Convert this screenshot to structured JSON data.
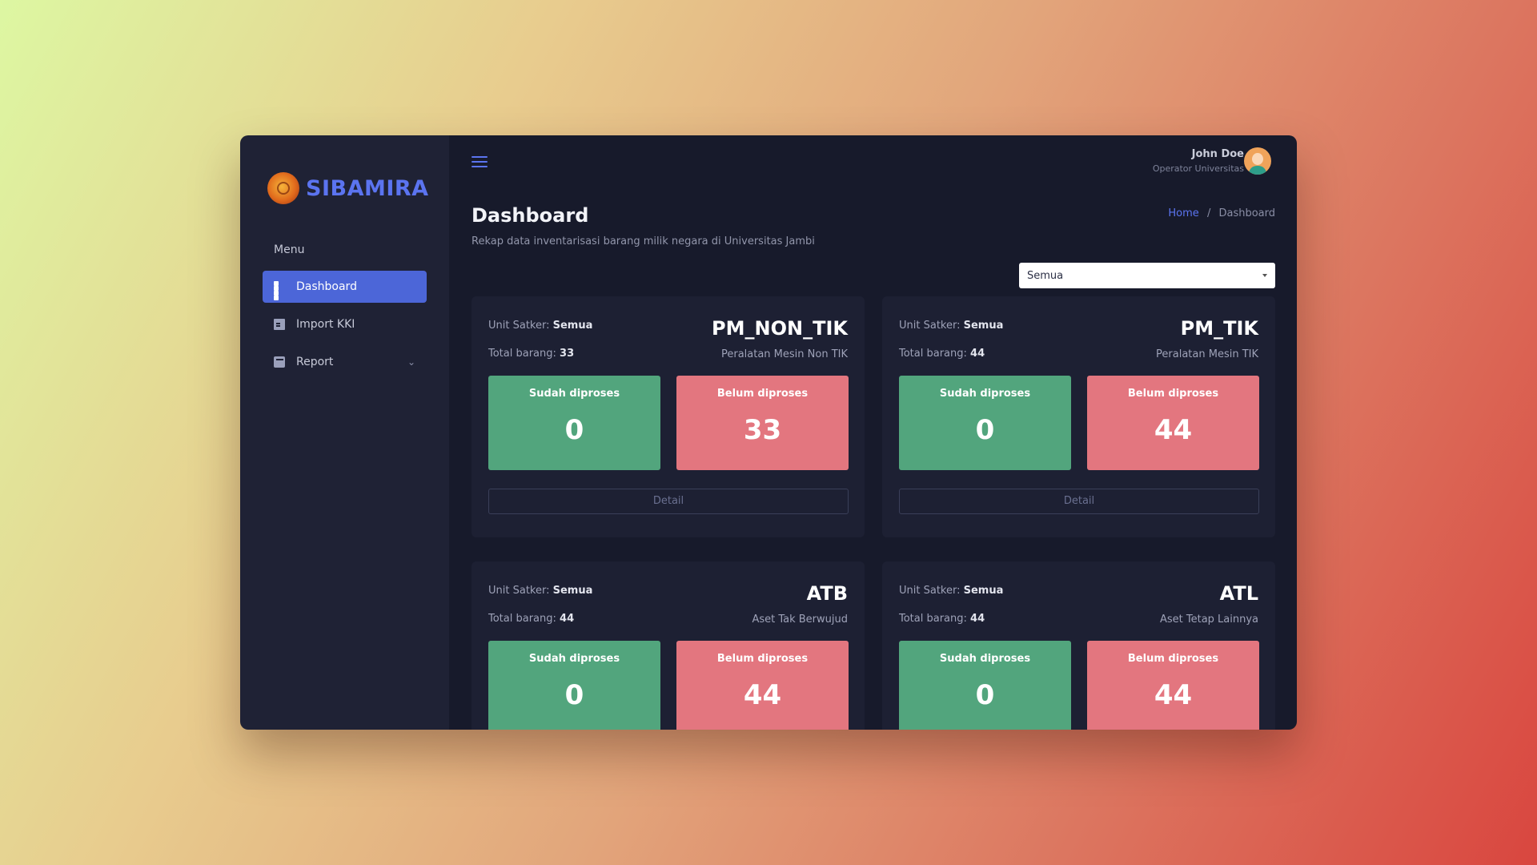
{
  "brand": {
    "name": "SIBAMIRA"
  },
  "sidebar": {
    "menu_label": "Menu",
    "items": [
      {
        "label": "Dashboard",
        "icon": "grid-icon",
        "active": true
      },
      {
        "label": "Import KKI",
        "icon": "file-icon"
      },
      {
        "label": "Report",
        "icon": "report-icon"
      }
    ]
  },
  "header": {
    "user_name": "John Doe",
    "user_role": "Operator Universitas"
  },
  "page": {
    "title": "Dashboard",
    "subtitle": "Rekap data inventarisasi barang milik negara di Universitas Jambi",
    "breadcrumb": {
      "home": "Home",
      "separator": "/",
      "current": "Dashboard"
    },
    "filter_value": "Semua"
  },
  "labels": {
    "unit_satker": "Unit Satker:",
    "total_barang": "Total barang:",
    "sudah": "Sudah diproses",
    "belum": "Belum diproses",
    "detail": "Detail"
  },
  "colors": {
    "accent": "#4c66d8",
    "processed": "#52a57d",
    "unprocessed": "#e3767f"
  },
  "cards": [
    {
      "unit": "Semua",
      "total": "33",
      "code": "PM_NON_TIK",
      "desc": "Peralatan Mesin Non TIK",
      "sudah": "0",
      "belum": "33"
    },
    {
      "unit": "Semua",
      "total": "44",
      "code": "PM_TIK",
      "desc": "Peralatan Mesin TIK",
      "sudah": "0",
      "belum": "44"
    },
    {
      "unit": "Semua",
      "total": "44",
      "code": "ATB",
      "desc": "Aset Tak Berwujud",
      "sudah": "0",
      "belum": "44"
    },
    {
      "unit": "Semua",
      "total": "44",
      "code": "ATL",
      "desc": "Aset Tetap Lainnya",
      "sudah": "0",
      "belum": "44"
    }
  ]
}
